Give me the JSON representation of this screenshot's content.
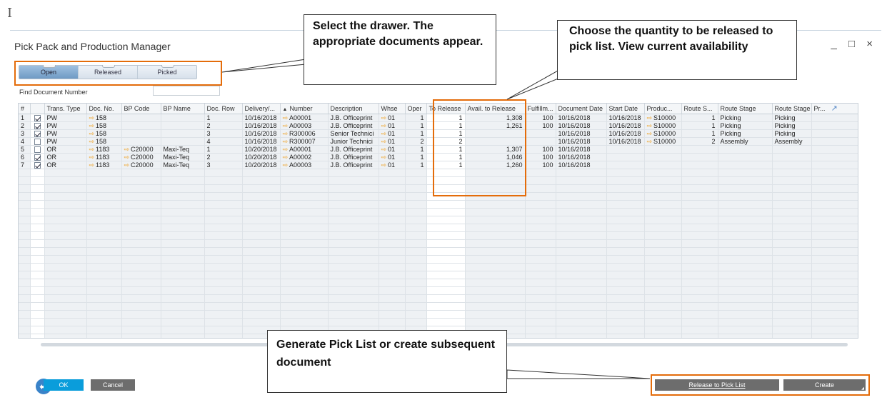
{
  "window": {
    "title": "Pick Pack and Production Manager",
    "controls": [
      "_",
      "□",
      "×"
    ]
  },
  "tabs": [
    {
      "label": "Open",
      "active": true
    },
    {
      "label": "Released",
      "active": false
    },
    {
      "label": "Picked",
      "active": false
    }
  ],
  "find": {
    "label": "Find Document Number",
    "value": ""
  },
  "table": {
    "columns": [
      "#",
      "",
      "Trans. Type",
      "Doc. No.",
      "BP Code",
      "BP Name",
      "Doc. Row",
      "Delivery/...",
      "Number",
      "Description",
      "Whse",
      "Oper",
      "To Release",
      "Avail. to Release",
      "Fulfillm...",
      "Document Date",
      "Start Date",
      "Produc...",
      "Route S...",
      "Route Stage",
      "Route Stage ...",
      "Pr..."
    ],
    "sort_indicator": "▲",
    "expand_icon": "↗",
    "rows": [
      {
        "n": "1",
        "checked": true,
        "type": "PW",
        "doc": "158",
        "bp_code": "",
        "bp_name": "",
        "row": "1",
        "delivery": "10/16/2018",
        "number": "A00001",
        "desc": "J.B. Officeprint",
        "whse": "01",
        "open": "1",
        "to_release": "1",
        "avail": "1,308",
        "fulfill": "100",
        "doc_date": "10/16/2018",
        "start": "10/16/2018",
        "prod": "S10000",
        "route_s": "1",
        "route_stage": "Picking",
        "route_stage2": "Picking"
      },
      {
        "n": "2",
        "checked": true,
        "type": "PW",
        "doc": "158",
        "bp_code": "",
        "bp_name": "",
        "row": "2",
        "delivery": "10/16/2018",
        "number": "A00003",
        "desc": "J.B. Officeprint",
        "whse": "01",
        "open": "1",
        "to_release": "1",
        "avail": "1,261",
        "fulfill": "100",
        "doc_date": "10/16/2018",
        "start": "10/16/2018",
        "prod": "S10000",
        "route_s": "1",
        "route_stage": "Picking",
        "route_stage2": "Picking"
      },
      {
        "n": "3",
        "checked": true,
        "type": "PW",
        "doc": "158",
        "bp_code": "",
        "bp_name": "",
        "row": "3",
        "delivery": "10/16/2018",
        "number": "R300006",
        "desc": "Senior Technici",
        "whse": "01",
        "open": "1",
        "to_release": "1",
        "avail": "",
        "fulfill": "",
        "doc_date": "10/16/2018",
        "start": "10/16/2018",
        "prod": "S10000",
        "route_s": "1",
        "route_stage": "Picking",
        "route_stage2": "Picking"
      },
      {
        "n": "4",
        "checked": false,
        "type": "PW",
        "doc": "158",
        "bp_code": "",
        "bp_name": "",
        "row": "4",
        "delivery": "10/16/2018",
        "number": "R300007",
        "desc": "Junior Technici",
        "whse": "01",
        "open": "2",
        "to_release": "2",
        "avail": "",
        "fulfill": "",
        "doc_date": "10/16/2018",
        "start": "10/16/2018",
        "prod": "S10000",
        "route_s": "2",
        "route_stage": "Assembly",
        "route_stage2": "Assembly"
      },
      {
        "n": "5",
        "checked": false,
        "type": "OR",
        "doc": "1183",
        "bp_code": "C20000",
        "bp_name": "Maxi-Teq",
        "row": "1",
        "delivery": "10/20/2018",
        "number": "A00001",
        "desc": "J.B. Officeprint",
        "whse": "01",
        "open": "1",
        "to_release": "1",
        "avail": "1,307",
        "fulfill": "100",
        "doc_date": "10/16/2018",
        "start": "",
        "prod": "",
        "route_s": "",
        "route_stage": "",
        "route_stage2": ""
      },
      {
        "n": "6",
        "checked": true,
        "type": "OR",
        "doc": "1183",
        "bp_code": "C20000",
        "bp_name": "Maxi-Teq",
        "row": "2",
        "delivery": "10/20/2018",
        "number": "A00002",
        "desc": "J.B. Officeprint",
        "whse": "01",
        "open": "1",
        "to_release": "1",
        "avail": "1,046",
        "fulfill": "100",
        "doc_date": "10/16/2018",
        "start": "",
        "prod": "",
        "route_s": "",
        "route_stage": "",
        "route_stage2": ""
      },
      {
        "n": "7",
        "checked": true,
        "type": "OR",
        "doc": "1183",
        "bp_code": "C20000",
        "bp_name": "Maxi-Teq",
        "row": "3",
        "delivery": "10/20/2018",
        "number": "A00003",
        "desc": "J.B. Officeprint",
        "whse": "01",
        "open": "1",
        "to_release": "1",
        "avail": "1,260",
        "fulfill": "100",
        "doc_date": "10/16/2018",
        "start": "",
        "prod": "",
        "route_s": "",
        "route_stage": "",
        "route_stage2": ""
      }
    ]
  },
  "buttons": {
    "ok": "OK",
    "cancel": "Cancel",
    "release": "Release to Pick List",
    "create": "Create"
  },
  "callouts": {
    "drawer": "Select the drawer. The appropriate documents appear.",
    "quantity": "Choose the quantity to be released to pick list. View current availability",
    "generate": "Generate Pick List or create subsequent document"
  },
  "colors": {
    "highlight": "#e46c0a",
    "ok_button": "#0a9ddb",
    "gray_button": "#6d6d6d",
    "link_arrow": "#f0a020"
  },
  "icons": {
    "link_arrow": "⇨",
    "back": "⬅"
  }
}
